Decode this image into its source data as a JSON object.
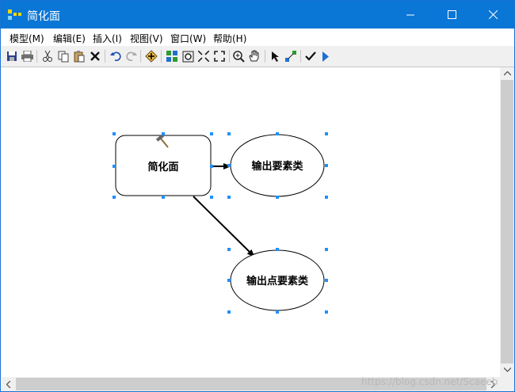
{
  "window": {
    "title": "简化面",
    "minimize_glyph": "—",
    "maximize_glyph": "☐",
    "close_glyph": "✕"
  },
  "menu": [
    {
      "label": "模型(M)"
    },
    {
      "label": "编辑(E)"
    },
    {
      "label": "插入(I)"
    },
    {
      "label": "视图(V)"
    },
    {
      "label": "窗口(W)"
    },
    {
      "label": "帮助(H)"
    }
  ],
  "toolbar": {
    "icons": [
      "save-icon",
      "print-icon",
      "cut-icon",
      "copy-icon",
      "paste-icon",
      "delete-icon",
      "undo-icon",
      "redo-icon",
      "add-data-icon",
      "auto-layout-icon",
      "full-extent-icon",
      "zoom-in-fixed-icon",
      "zoom-out-fixed-icon",
      "zoom-in-icon",
      "pan-icon",
      "select-icon",
      "connect-icon",
      "validate-icon",
      "run-icon"
    ]
  },
  "diagram": {
    "process": {
      "label": "简化面"
    },
    "output1": {
      "label": "输出要素类"
    },
    "output2": {
      "label": "输出点要素类"
    },
    "colors": {
      "handle": "#1e90ff",
      "stroke": "#000000"
    }
  },
  "watermark": "https://blog.csdn.net/Scaeeb"
}
